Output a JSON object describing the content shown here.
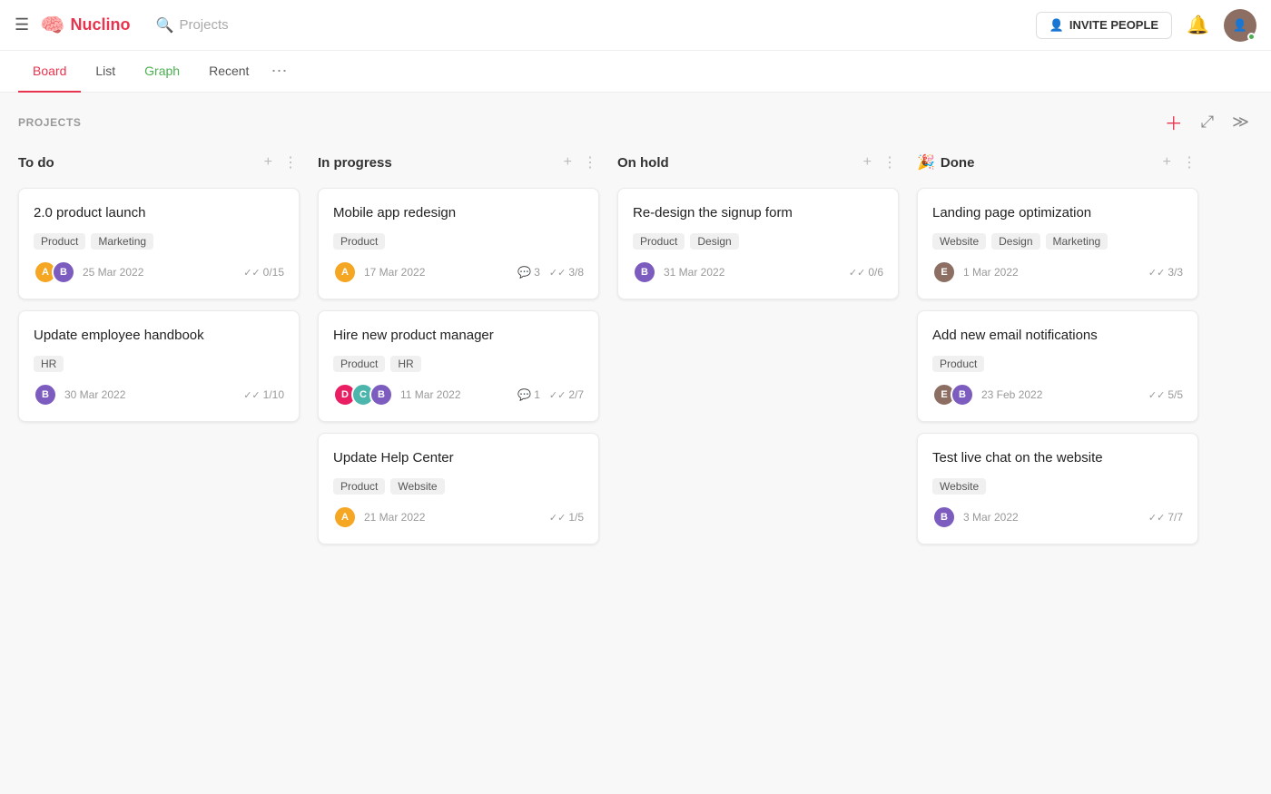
{
  "header": {
    "hamburger_label": "☰",
    "logo_text": "Nuclino",
    "logo_icon": "🧠",
    "search_placeholder": "Projects",
    "invite_label": "INVITE PEOPLE",
    "invite_icon": "👤+",
    "bell_icon": "🔔"
  },
  "tabs": [
    {
      "id": "board",
      "label": "Board",
      "active": true
    },
    {
      "id": "list",
      "label": "List",
      "active": false
    },
    {
      "id": "graph",
      "label": "Graph",
      "active": false
    },
    {
      "id": "recent",
      "label": "Recent",
      "active": false
    }
  ],
  "toolbar": {
    "projects_label": "PROJECTS"
  },
  "columns": [
    {
      "id": "todo",
      "title": "To do",
      "emoji": "",
      "cards": [
        {
          "id": "card-1",
          "title": "2.0 product launch",
          "tags": [
            "Product",
            "Marketing"
          ],
          "avatars": [
            "av-orange",
            "av-purple"
          ],
          "date": "25 Mar 2022",
          "checks": "0/15",
          "comments": ""
        },
        {
          "id": "card-2",
          "title": "Update employee handbook",
          "tags": [
            "HR"
          ],
          "avatars": [
            "av-purple"
          ],
          "date": "30 Mar 2022",
          "checks": "1/10",
          "comments": ""
        }
      ]
    },
    {
      "id": "inprogress",
      "title": "In progress",
      "emoji": "",
      "cards": [
        {
          "id": "card-3",
          "title": "Mobile app redesign",
          "tags": [
            "Product"
          ],
          "avatars": [
            "av-orange"
          ],
          "date": "17 Mar 2022",
          "checks": "3/8",
          "comments": "3"
        },
        {
          "id": "card-4",
          "title": "Hire new product manager",
          "tags": [
            "Product",
            "HR"
          ],
          "avatars": [
            "av-pink",
            "av-teal",
            "av-purple"
          ],
          "date": "11 Mar 2022",
          "checks": "2/7",
          "comments": "1"
        },
        {
          "id": "card-5",
          "title": "Update Help Center",
          "tags": [
            "Product",
            "Website"
          ],
          "avatars": [
            "av-orange"
          ],
          "date": "21 Mar 2022",
          "checks": "1/5",
          "comments": ""
        }
      ]
    },
    {
      "id": "onhold",
      "title": "On hold",
      "emoji": "",
      "cards": [
        {
          "id": "card-6",
          "title": "Re-design the signup form",
          "tags": [
            "Product",
            "Design"
          ],
          "avatars": [
            "av-purple"
          ],
          "date": "31 Mar 2022",
          "checks": "0/6",
          "comments": ""
        }
      ]
    },
    {
      "id": "done",
      "title": "Done",
      "emoji": "🎉",
      "cards": [
        {
          "id": "card-7",
          "title": "Landing page optimization",
          "tags": [
            "Website",
            "Design",
            "Marketing"
          ],
          "avatars": [
            "av-brown"
          ],
          "date": "1 Mar 2022",
          "checks": "3/3",
          "comments": ""
        },
        {
          "id": "card-8",
          "title": "Add new email notifications",
          "tags": [
            "Product"
          ],
          "avatars": [
            "av-brown",
            "av-purple"
          ],
          "date": "23 Feb 2022",
          "checks": "5/5",
          "comments": ""
        },
        {
          "id": "card-9",
          "title": "Test live chat on the website",
          "tags": [
            "Website"
          ],
          "avatars": [
            "av-purple"
          ],
          "date": "3 Mar 2022",
          "checks": "7/7",
          "comments": ""
        }
      ]
    }
  ]
}
